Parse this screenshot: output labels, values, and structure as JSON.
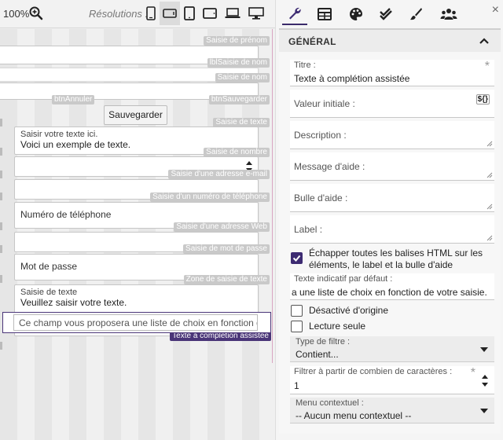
{
  "toolbar": {
    "zoom": "100%",
    "zoom_icon": "zoom-in-icon",
    "resolutions_label": "Résolutions :",
    "resolutions": [
      "phone-portrait",
      "phone-landscape",
      "tablet-portrait",
      "tablet-landscape",
      "laptop",
      "desktop"
    ]
  },
  "canvas": {
    "tags": {
      "prenom": "Saisie de prénom",
      "lbl_nom": "lblSaisie de nom",
      "nom": "Saisie de nom",
      "btn_annuler": "btnAnnuler",
      "btn_sauvegarder": "btnSauvegarder",
      "texte": "Saisie de texte",
      "nombre": "Saisie de nombre",
      "email": "Saisie d'une adresse e-mail",
      "tel": "Saisie d'un numéro de téléphone",
      "web": "Saisie d'une adresse Web",
      "mdp": "Saisie de mot de passe",
      "zone": "Zone de saisie de texte",
      "autocomplete": "Texte à complétion assistée"
    },
    "save_button": "Sauvegarder",
    "text_field": {
      "label": "Saisir votre texte ici.",
      "value": "Voici un exemple de texte."
    },
    "phone_field": "Numéro de téléphone",
    "password_field": "Mot de passe",
    "textarea": {
      "label": "Saisie de texte",
      "value": "Veuillez saisir votre texte."
    },
    "autocomplete_field": "Ce champ vous proposera une liste de choix en fonction de votre saisie."
  },
  "panel": {
    "tabs": [
      "wrench-icon",
      "table-icon",
      "palette-icon",
      "double-check-icon",
      "brush-icon",
      "users-icon"
    ],
    "close": "×",
    "section_title": "GÉNÉRAL",
    "titre": {
      "label": "Titre :",
      "value": "Texte à complétion assistée"
    },
    "valeur_initiale": {
      "label": "Valeur initiale :",
      "badge": "${}"
    },
    "description": {
      "label": "Description :"
    },
    "message_aide": {
      "label": "Message d'aide :"
    },
    "bulle_aide": {
      "label": "Bulle d'aide :"
    },
    "label_field": {
      "label": "Label :"
    },
    "escape_html": {
      "label": "Échapper toutes les balises HTML sur les éléments, le label et la bulle d'aide",
      "checked": true
    },
    "placeholder": {
      "label": "Texte indicatif par défaut :",
      "value": "a une liste de choix en fonction de votre saisie."
    },
    "disabled": {
      "label": "Désactivé d'origine",
      "checked": false
    },
    "readonly": {
      "label": "Lecture seule",
      "checked": false
    },
    "filter_type": {
      "label": "Type de filtre :",
      "value": "Contient..."
    },
    "filter_min": {
      "label": "Filtrer à partir de combien de caractères :",
      "value": "1"
    },
    "context_menu": {
      "label": "Menu contextuel :",
      "value": "-- Aucun menu contextuel --"
    }
  },
  "colors": {
    "accent": "#3d2b72",
    "active_tag": "#4a3578",
    "tag": "#c9c9c9"
  }
}
